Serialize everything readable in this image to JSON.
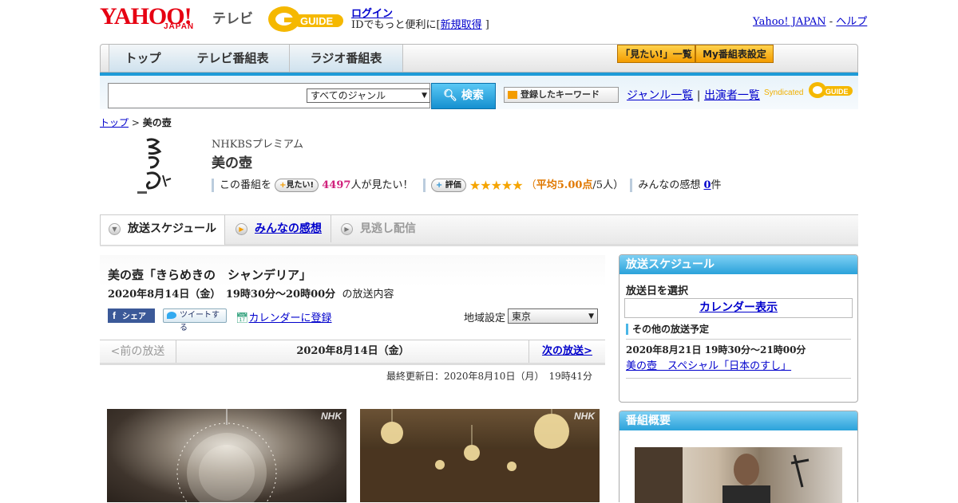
{
  "header": {
    "logo_yahoo": "YAHOO!",
    "logo_japan": "JAPAN",
    "logo_tv": "テレビ",
    "logo_gguide": "G-GUIDE",
    "login_label": "ログイン",
    "login_sub_prefix": "IDでもっと便利に[",
    "signup_label": "新規取得",
    "login_sub_suffix": "]",
    "yahoo_japan_link": "Yahoo! JAPAN",
    "dash": " - ",
    "help_link": "ヘルプ"
  },
  "nav": {
    "tabs": [
      "トップ",
      "テレビ番組表",
      "ラジオ番組表"
    ],
    "mitai_list": "「見たい!」一覧",
    "my_schedule": "My番組表設定"
  },
  "search": {
    "genre_selected": "すべてのジャンル",
    "button_label": "検索",
    "keyword_button": "登録したキーワード",
    "genre_list_link": "ジャンル一覧",
    "divider": "|",
    "performer_list_link": "出演者一覧",
    "syndicated": "Syndicated"
  },
  "breadcrumb": {
    "top": "トップ",
    "sep": " > ",
    "current": "美の壺"
  },
  "program": {
    "station": "NHKBSプレミアム",
    "title": "美の壺",
    "this_program": "この番組を",
    "mitai_btn": "見たい!",
    "mitai_count": "4497",
    "mitai_suffix": "人が見たい！",
    "rate_btn": "評価",
    "stars": "★★★★★",
    "avg_prefix": "（",
    "avg_label": "平均5.00点",
    "avg_suffix": "/5人）",
    "impressions_label": "みんなの感想",
    "impressions_count": "0",
    "impressions_suffix": "件"
  },
  "content_tabs": [
    "放送スケジュール",
    "みんなの感想",
    "見逃し配信"
  ],
  "episode": {
    "title": "美の壺「きらめきの　シャンデリア」",
    "date": "2020年8月14日（金）　19時30分～20時00分",
    "date_suffix": "の放送内容",
    "fb_share": "シェア",
    "tweet": "ツイートする",
    "calendar_register": "カレンダーに登録",
    "region_label": "地域設定",
    "region_value": "東京"
  },
  "pager": {
    "prev": "<前の放送",
    "current_date": "2020年8月14日（金）",
    "next": "次の放送>"
  },
  "last_updated": "最終更新日：2020年8月10日（月）　19時41分",
  "photos": {
    "watermark": "NHK"
  },
  "sidebar": {
    "schedule_title": "放送スケジュール",
    "select_date": "放送日を選択",
    "calendar_link": "カレンダー表示",
    "other_label": "その他の放送予定",
    "other_date": "2020年8月21日 19時30分～21時00分",
    "other_episode": "美の壺　スペシャル「日本のすし」",
    "overview_title": "番組概要"
  },
  "colors": {
    "accent_blue": "#1e9bd7",
    "yahoo_red": "#e60012",
    "gguide_yellow": "#f5b800",
    "pink_count": "#d0217c"
  }
}
